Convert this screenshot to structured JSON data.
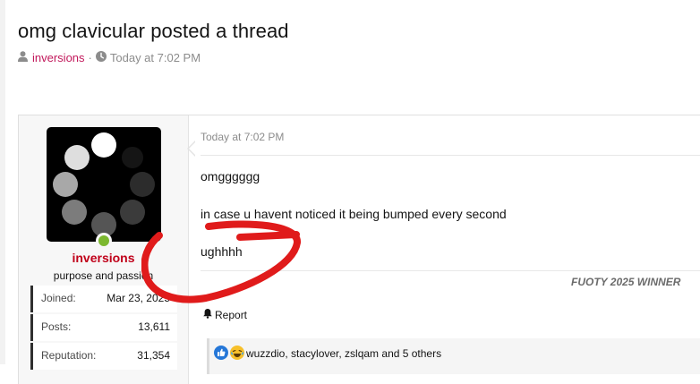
{
  "thread": {
    "title": "omg clavicular posted a thread",
    "author": "inversions",
    "separator": "·",
    "time": "Today at 7:02 PM"
  },
  "poster": {
    "username": "inversions",
    "user_title": "purpose and passion",
    "online": true,
    "stats": [
      {
        "key": "Joined:",
        "value": "Mar 23, 2025"
      },
      {
        "key": "Posts:",
        "value": "13,611"
      },
      {
        "key": "Reputation:",
        "value": "31,354"
      }
    ]
  },
  "post": {
    "date": "Today at 7:02 PM",
    "lines": [
      "omgggggg",
      "in case u havent noticed it being bumped every second",
      "ughhhh"
    ],
    "signature": "FUOTY 2025 WINNER",
    "report_label": "Report",
    "reactions_text": "wuzzdio, stacylover, zslqam and 5 others"
  },
  "colors": {
    "author_link": "#c2185b",
    "username": "#c0001a",
    "online": "#7cb82f",
    "annotation": "#e01b1b"
  }
}
